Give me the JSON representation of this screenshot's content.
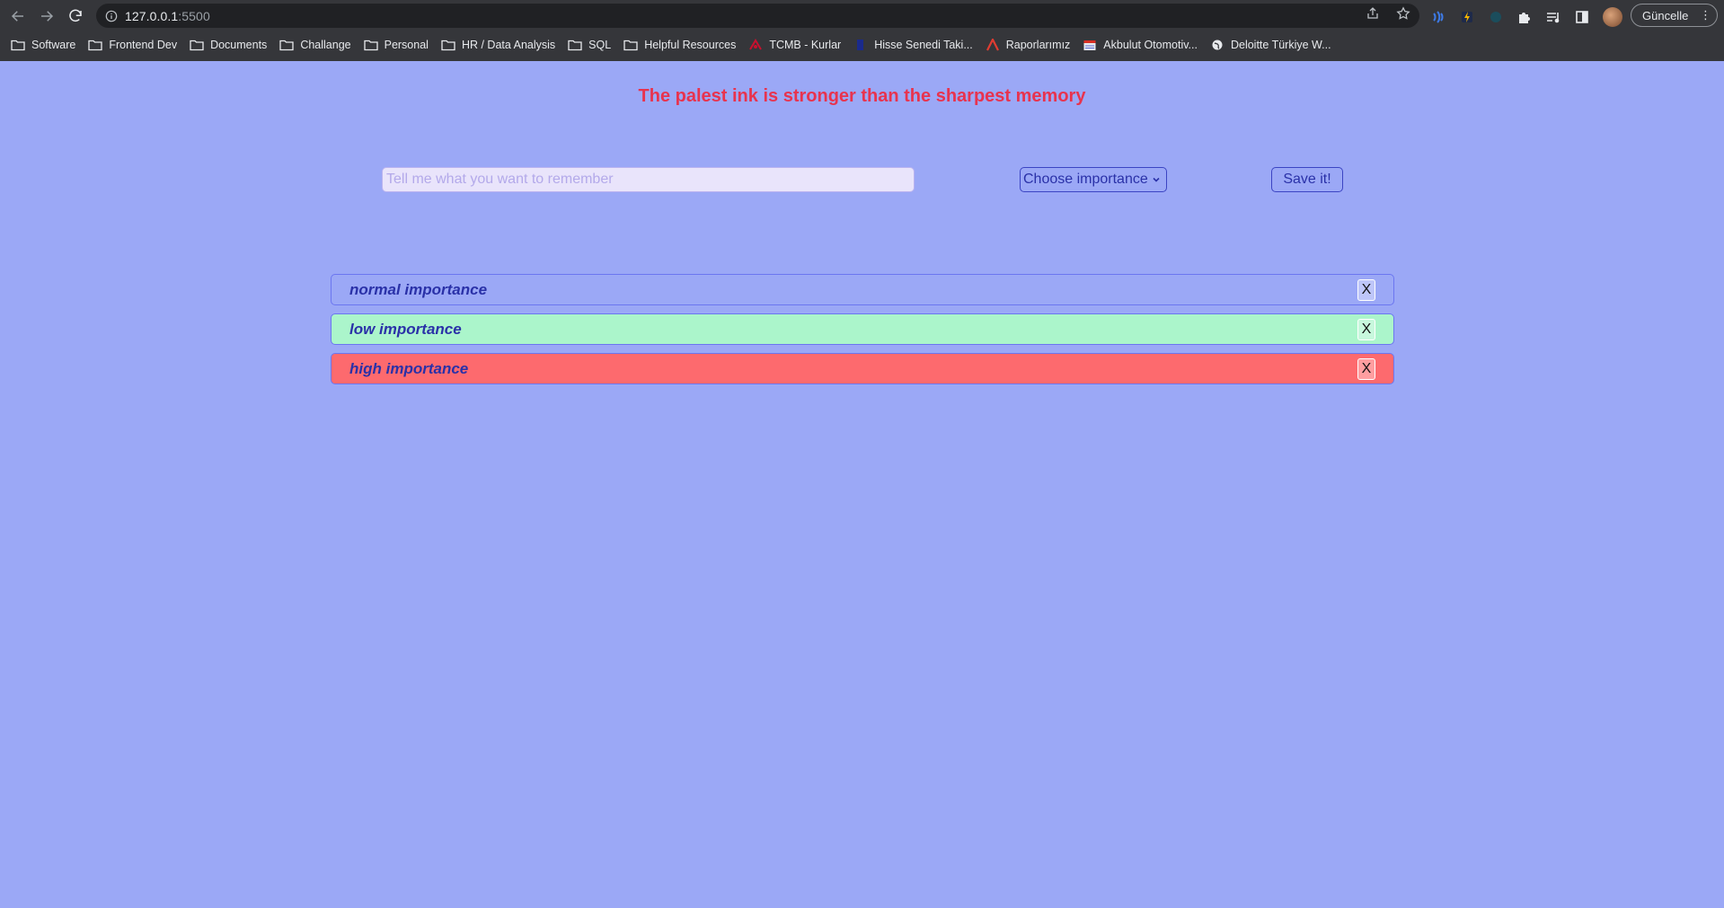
{
  "browser": {
    "url_host": "127.0.0.1",
    "url_port": ":5500",
    "update_label": "Güncelle",
    "bookmarks": [
      {
        "label": "Software",
        "icon": "folder-icon"
      },
      {
        "label": "Frontend Dev",
        "icon": "folder-icon"
      },
      {
        "label": "Documents",
        "icon": "folder-icon"
      },
      {
        "label": "Challange",
        "icon": "folder-icon"
      },
      {
        "label": "Personal",
        "icon": "folder-icon"
      },
      {
        "label": "HR / Data Analysis",
        "icon": "folder-icon"
      },
      {
        "label": "SQL",
        "icon": "folder-icon"
      },
      {
        "label": "Helpful Resources",
        "icon": "folder-icon"
      },
      {
        "label": "TCMB - Kurlar",
        "icon": "tcmb-icon"
      },
      {
        "label": "Hisse Senedi Taki...",
        "icon": "bookmark-icon"
      },
      {
        "label": "Raporlarımız",
        "icon": "report-icon"
      },
      {
        "label": "Akbulut Otomotiv...",
        "icon": "calendar-icon"
      },
      {
        "label": "Deloitte Türkiye W...",
        "icon": "globe-icon"
      }
    ]
  },
  "app": {
    "headline": "The palest ink is stronger than the sharpest memory",
    "input_placeholder": "Tell me what you want to remember",
    "select_label": "Choose importance",
    "save_label": "Save it!",
    "memos": [
      {
        "text": "normal importance",
        "importance": "normal",
        "color": "#9ba8f6",
        "remove_label": "X"
      },
      {
        "text": "low importance",
        "importance": "low",
        "color": "#abf5cb",
        "remove_label": "X"
      },
      {
        "text": "high importance",
        "importance": "high",
        "color": "#fd6a6e",
        "remove_label": "X"
      }
    ]
  },
  "colors": {
    "page_background": "#9ba8f6",
    "headline": "#e8334e",
    "accent": "#2a31a8"
  }
}
